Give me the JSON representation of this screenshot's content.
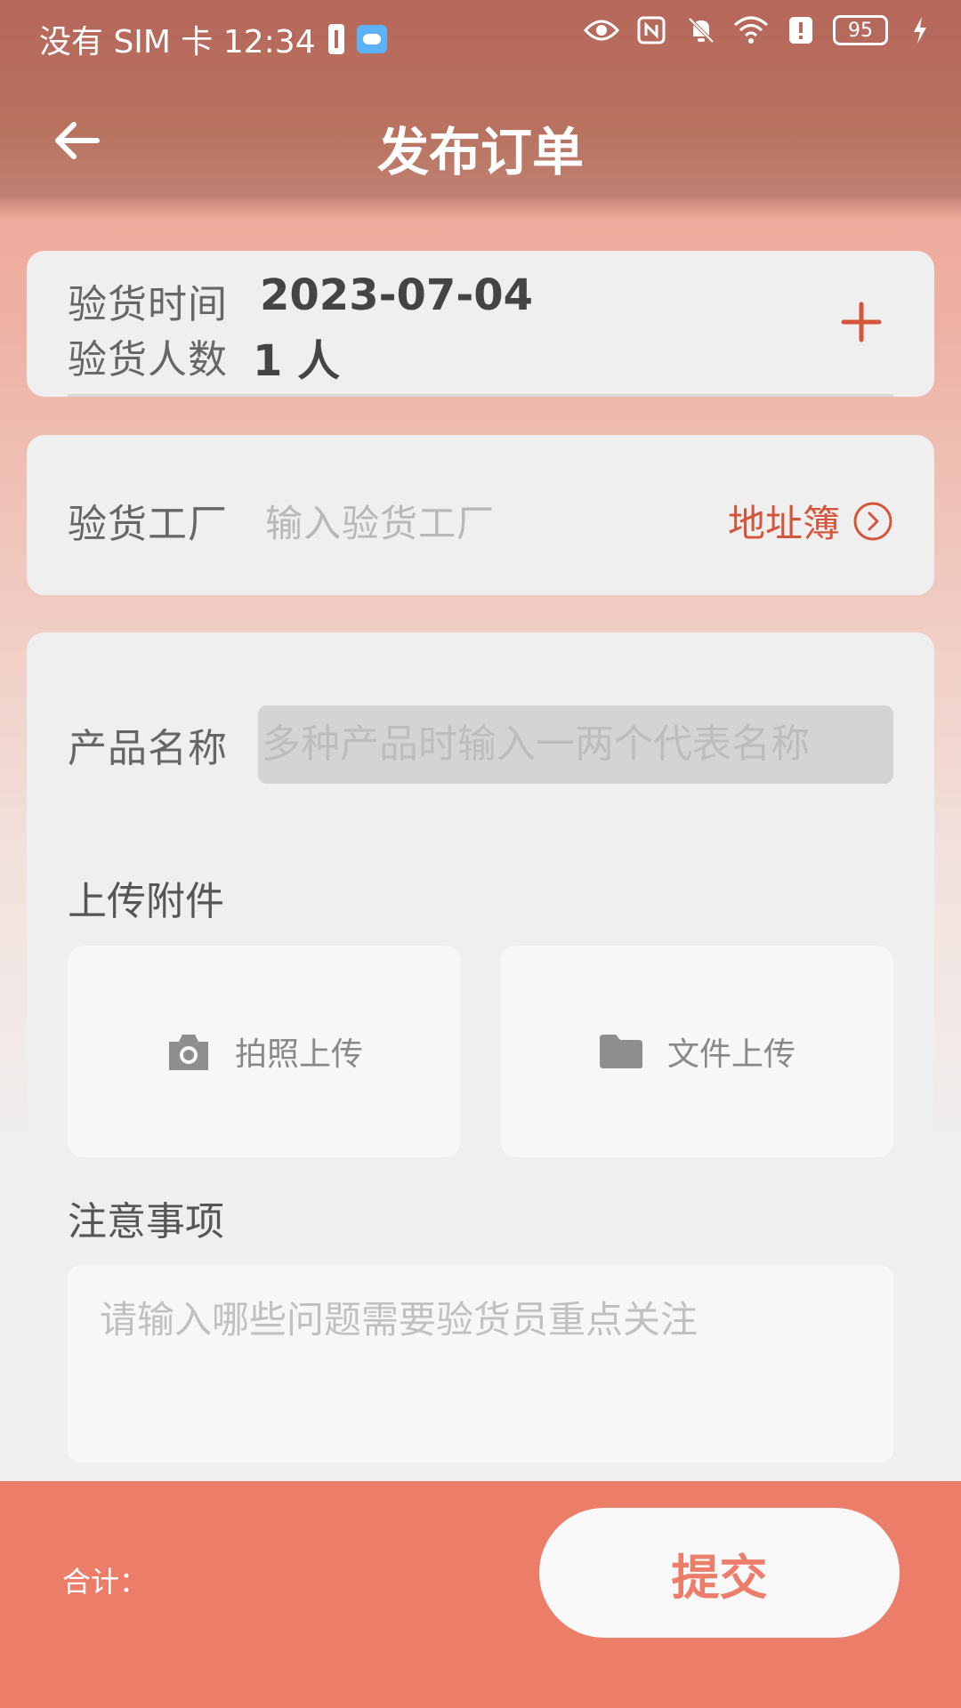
{
  "status_bar": {
    "carrier_time": "没有 SIM 卡 12:34",
    "battery_level": "95",
    "icons": [
      "battery-alert-icon",
      "weather-cloud-icon",
      "eye-icon",
      "nfc-icon",
      "bell-off-icon",
      "wifi-icon",
      "alert-icon",
      "battery-icon",
      "charging-icon"
    ]
  },
  "header": {
    "title": "发布订单"
  },
  "inspection": {
    "time_label": "验货时间",
    "time_value": "2023-07-04",
    "count_label": "验货人数",
    "count_value": "1 人"
  },
  "factory": {
    "label": "验货工厂",
    "placeholder": "输入验货工厂",
    "address_book": "地址簿"
  },
  "product": {
    "label": "产品名称",
    "placeholder": "多种产品时输入一两个代表名称"
  },
  "attachments": {
    "title": "上传附件",
    "photo_label": "拍照上传",
    "file_label": "文件上传"
  },
  "notes": {
    "title": "注意事项",
    "placeholder": "请输入哪些问题需要验货员重点关注"
  },
  "footer": {
    "total_label": "合计：",
    "submit_label": "提交"
  },
  "colors": {
    "accent": "#EC7E69",
    "link": "#D4553B",
    "header": "#B6675A"
  }
}
